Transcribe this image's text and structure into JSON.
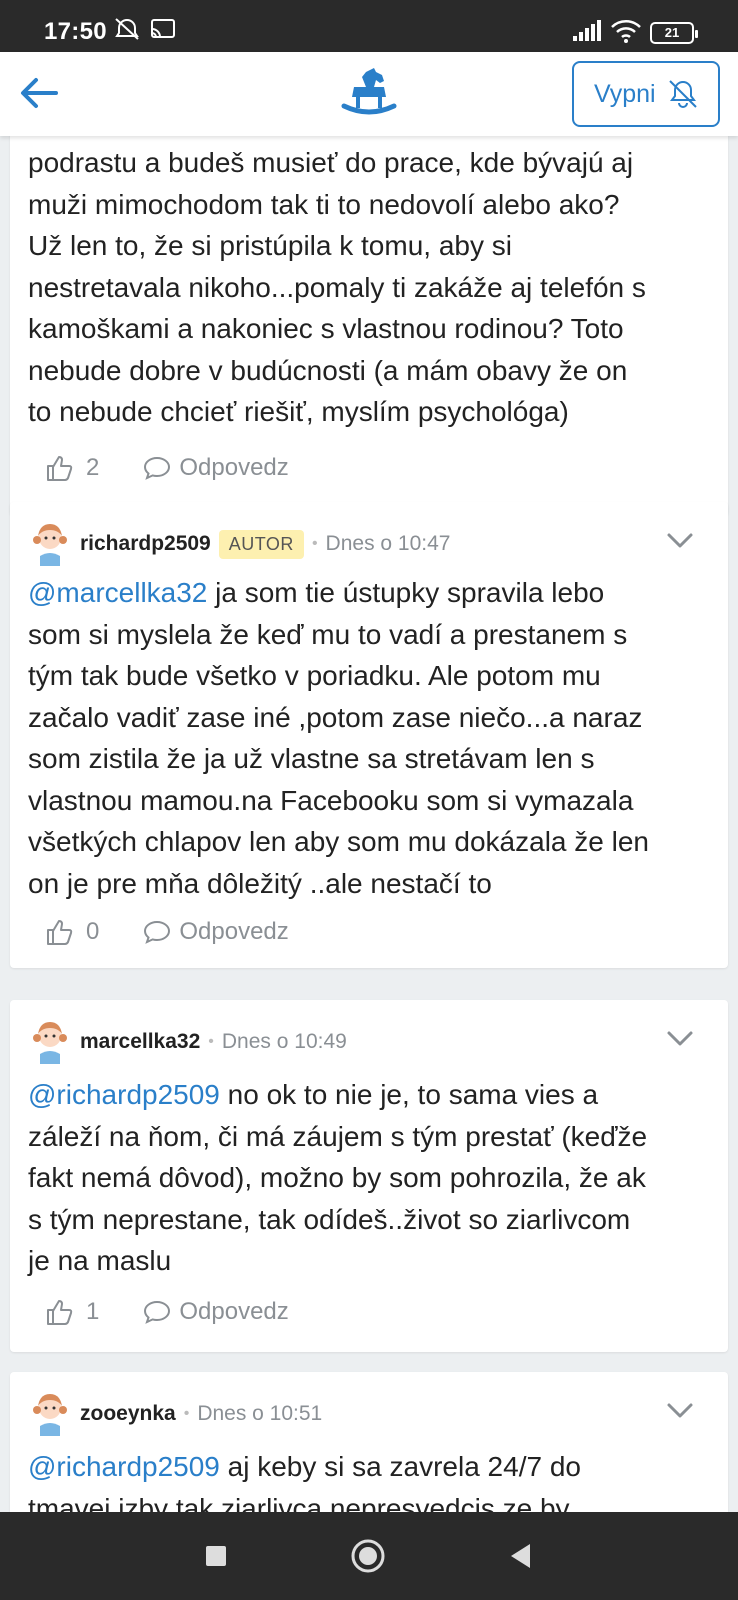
{
  "status_bar": {
    "time": "17:50",
    "battery": "21"
  },
  "app_bar": {
    "mute_button_label": "Vypni"
  },
  "comments": [
    {
      "text_lines": [
        "podrastu a budeš musieť do prace, kde bývajú aj",
        "muži mimochodom tak ti to nedovolí alebo ako?",
        "Už len to, že si pristúpila k tomu, aby si",
        "nestretavala nikoho...pomaly ti zakáže aj telefón s",
        "kamoškami a nakoniec s vlastnou rodinou? Toto",
        "nebude dobre v budúcnosti (a mám obavy že on",
        "to nebude chcieť riešiť, myslím psychológa)"
      ],
      "likes": "2",
      "reply_label": "Odpovedz"
    },
    {
      "username": "richardp2509",
      "badge": "AUTOR",
      "timestamp": "Dnes o 10:47",
      "mention": "@marcellka32",
      "first_line_rest": " ja som tie ústupky spravila lebo",
      "text_lines": [
        "som si myslela že keď mu to vadí a prestanem s",
        "tým tak bude všetko v poriadku. Ale potom mu",
        "začalo vadiť zase iné ,potom zase niečo...a naraz",
        "som zistila že ja už vlastne sa stretávam len s",
        "vlastnou mamou.na Facebooku som si vymazala",
        "všetkých chlapov len aby som mu dokázala že len",
        "on je pre mňa dôležitý ..ale nestačí to"
      ],
      "likes": "0",
      "reply_label": "Odpovedz"
    },
    {
      "username": "marcellka32",
      "timestamp": "Dnes o 10:49",
      "mention": "@richardp2509",
      "first_line_rest": " no ok to nie je, to sama vies a",
      "text_lines": [
        "záleží na ňom, či má záujem s tým prestať (keďže",
        "fakt nemá dôvod), možno by som pohrozila, že ak",
        "s tým neprestane, tak odídeš..život so ziarlivcom",
        "je na maslu"
      ],
      "likes": "1",
      "reply_label": "Odpovedz"
    },
    {
      "username": "zooeynka",
      "timestamp": "Dnes o 10:51",
      "mention": "@richardp2509",
      "first_line_rest": " aj keby si sa zavrela 24/7 do",
      "text_lines": [
        "tmavej izby tak ziarlivca nepresvedcis ze by"
      ]
    }
  ],
  "colors": {
    "accent": "#2a7fc9",
    "badge_bg": "#fdf0b0",
    "muted": "#8a8f94"
  },
  "icons": [
    "back-arrow-icon",
    "rocking-horse-logo-icon",
    "bell-off-icon",
    "thumbs-up-icon",
    "comment-bubble-icon",
    "chevron-down-icon",
    "avatar-icon"
  ]
}
